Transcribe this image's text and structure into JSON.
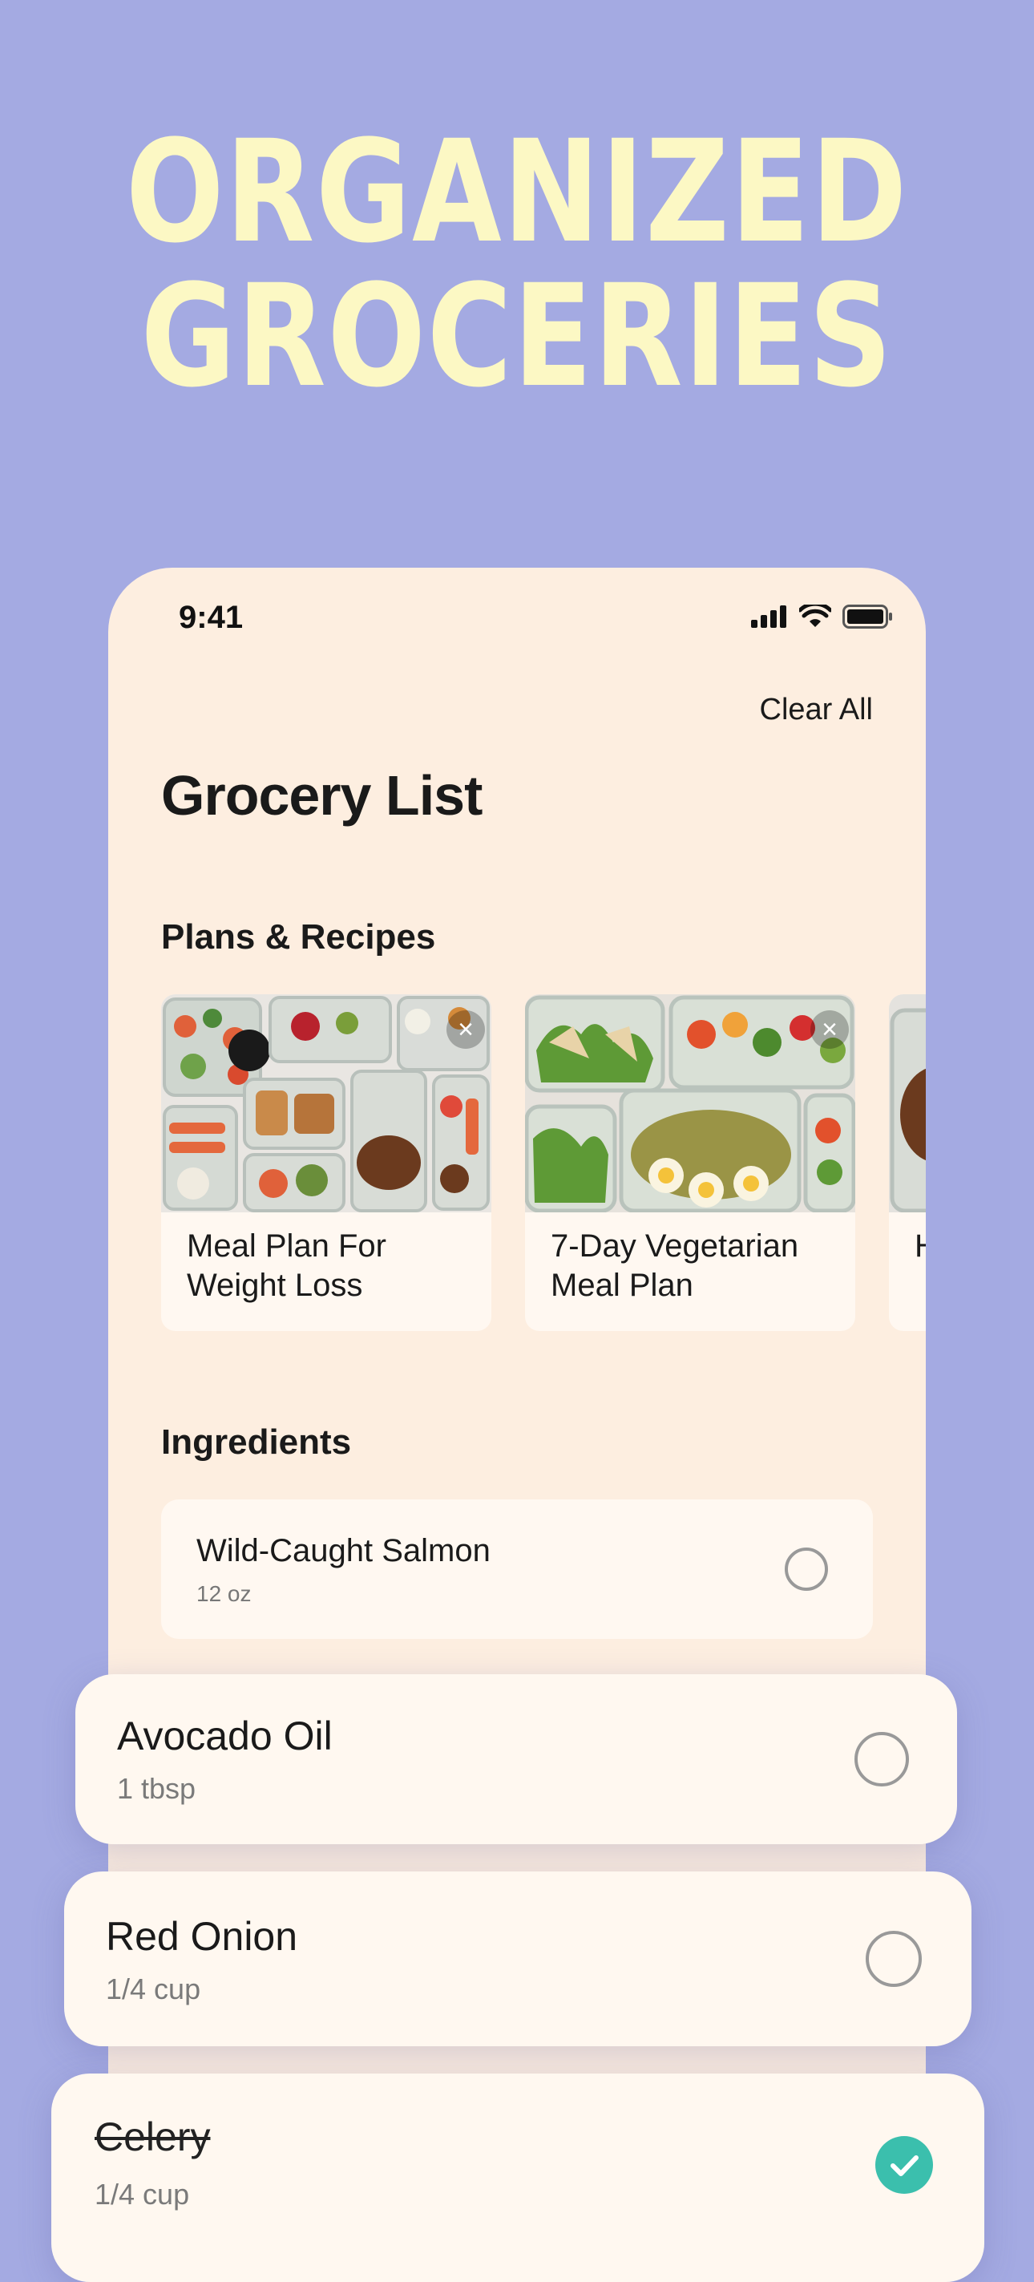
{
  "hero": {
    "line1": "ORGANIZED",
    "line2": "GROCERIES"
  },
  "status": {
    "time": "9:41",
    "icons": [
      "cellular-signal-icon",
      "wifi-icon",
      "battery-icon"
    ]
  },
  "header": {
    "clear_all": "Clear All",
    "title": "Grocery List"
  },
  "plans": {
    "section_title": "Plans & Recipes",
    "cards": [
      {
        "title": "Meal Plan For Weight Loss",
        "icon": "close-icon"
      },
      {
        "title": "7-Day Vegetarian Meal Plan",
        "icon": "close-icon"
      },
      {
        "title": "H",
        "icon": "close-icon"
      }
    ]
  },
  "ingredients": {
    "section_title": "Ingredients",
    "items": [
      {
        "name": "Wild-Caught Salmon",
        "qty": "12 oz",
        "checked": false
      },
      {
        "name": "Avocado Oil",
        "qty": "1 tbsp",
        "checked": false
      },
      {
        "name": "Red Onion",
        "qty": "1/4 cup",
        "checked": false
      },
      {
        "name": "Celery",
        "qty": "1/4 cup",
        "checked": true
      }
    ]
  },
  "colors": {
    "background": "#a4aae2",
    "hero_text": "#fcf8c4",
    "phone_bg": "#fdeee0",
    "card_bg": "#fff8f1",
    "check_accent": "#3bbfad"
  }
}
